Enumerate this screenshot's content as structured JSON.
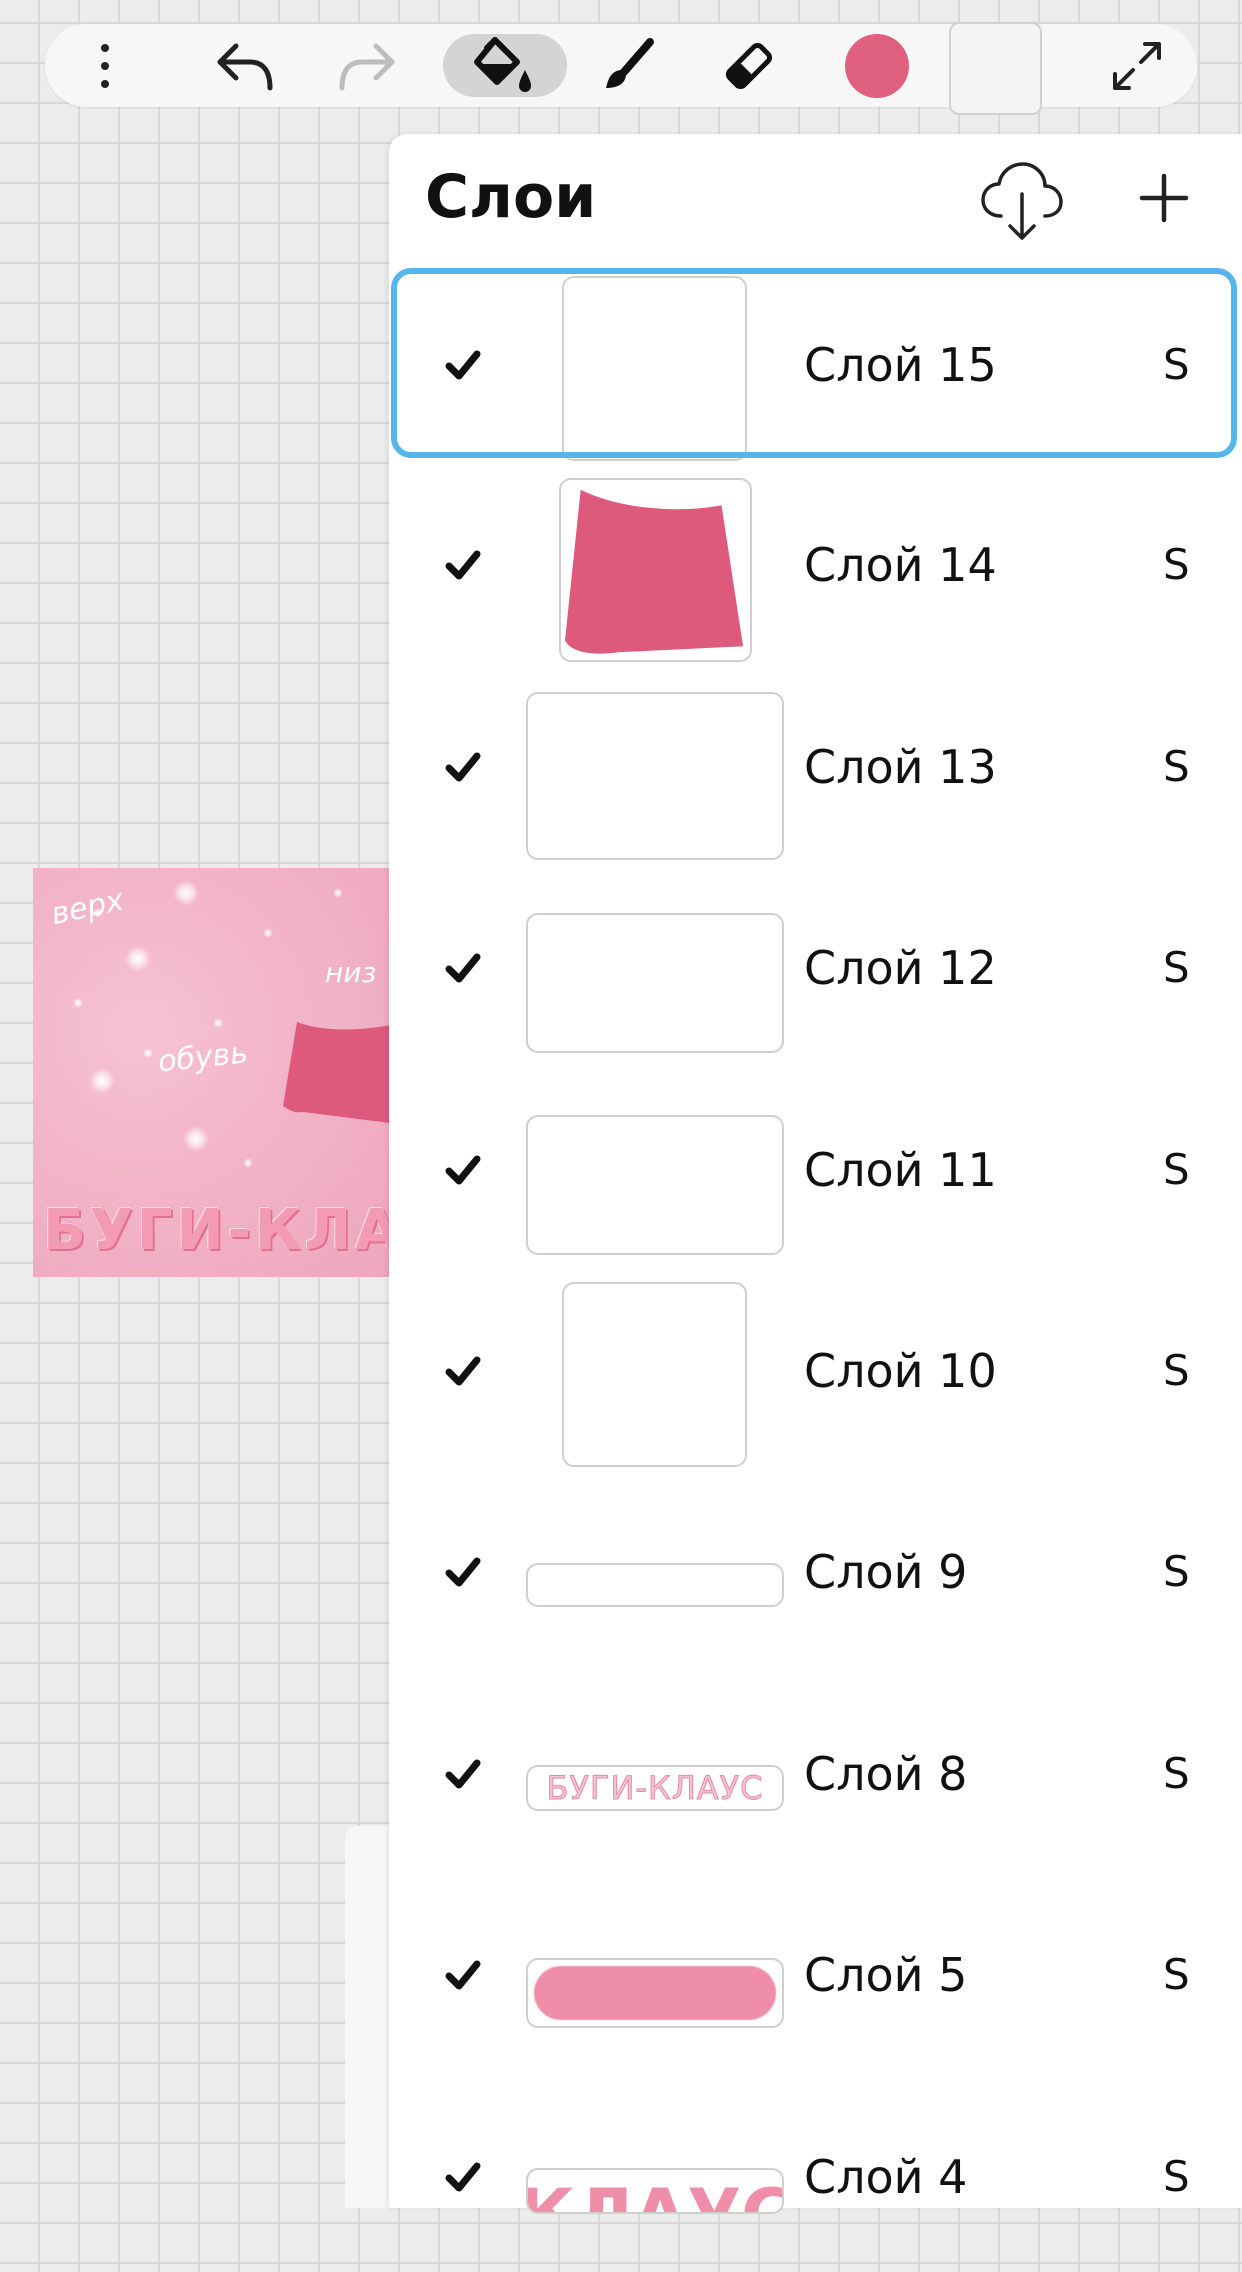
{
  "toolbar": {
    "items": [
      {
        "name": "more-menu",
        "icon": "vertical-dots-icon"
      },
      {
        "name": "undo",
        "icon": "undo-arrow-icon"
      },
      {
        "name": "redo",
        "icon": "redo-arrow-icon",
        "disabled": true
      },
      {
        "name": "fill-tool",
        "icon": "paint-bucket-icon",
        "active": true
      },
      {
        "name": "brush-tool",
        "icon": "brush-icon"
      },
      {
        "name": "eraser-tool",
        "icon": "eraser-icon"
      },
      {
        "name": "current-color",
        "icon": "color-dot"
      },
      {
        "name": "secondary-swatch",
        "icon": "blank-swatch"
      },
      {
        "name": "fullscreen",
        "icon": "expand-icon"
      }
    ],
    "current_color": "#e0607f",
    "secondary_color": "#f4f4f4"
  },
  "artwork": {
    "labels": {
      "top": "верх",
      "bottom": "низ",
      "shoes": "обувь"
    },
    "banner": "БУГИ-КЛАУС",
    "skirt_color": "#de5a7d",
    "background_color": "#f2b4c8"
  },
  "layers_panel": {
    "title": "Слои",
    "download_icon": "cloud-download-icon",
    "add_icon": "plus-icon",
    "selected_index": 0,
    "selection_color": "#56b6ec",
    "layers": [
      {
        "name": "Слой 15",
        "mode": "S",
        "visible": true,
        "thumb": "empty-portrait"
      },
      {
        "name": "Слой 14",
        "mode": "S",
        "visible": true,
        "thumb": "skirt"
      },
      {
        "name": "Слой 13",
        "mode": "S",
        "visible": true,
        "thumb": "empty-wide"
      },
      {
        "name": "Слой 12",
        "mode": "S",
        "visible": true,
        "thumb": "empty-wide-short"
      },
      {
        "name": "Слой 11",
        "mode": "S",
        "visible": true,
        "thumb": "empty-wide-short"
      },
      {
        "name": "Слой 10",
        "mode": "S",
        "visible": true,
        "thumb": "empty-portrait"
      },
      {
        "name": "Слой 9",
        "mode": "S",
        "visible": true,
        "thumb": "empty-strip"
      },
      {
        "name": "Слой 8",
        "mode": "S",
        "visible": true,
        "thumb": "text",
        "thumb_text": "БУГИ-КЛАУС"
      },
      {
        "name": "Слой 5",
        "mode": "S",
        "visible": true,
        "thumb": "pink-pill"
      },
      {
        "name": "Слой 4",
        "mode": "S",
        "visible": true,
        "thumb": "text",
        "thumb_text": "КЛАУС"
      }
    ]
  }
}
